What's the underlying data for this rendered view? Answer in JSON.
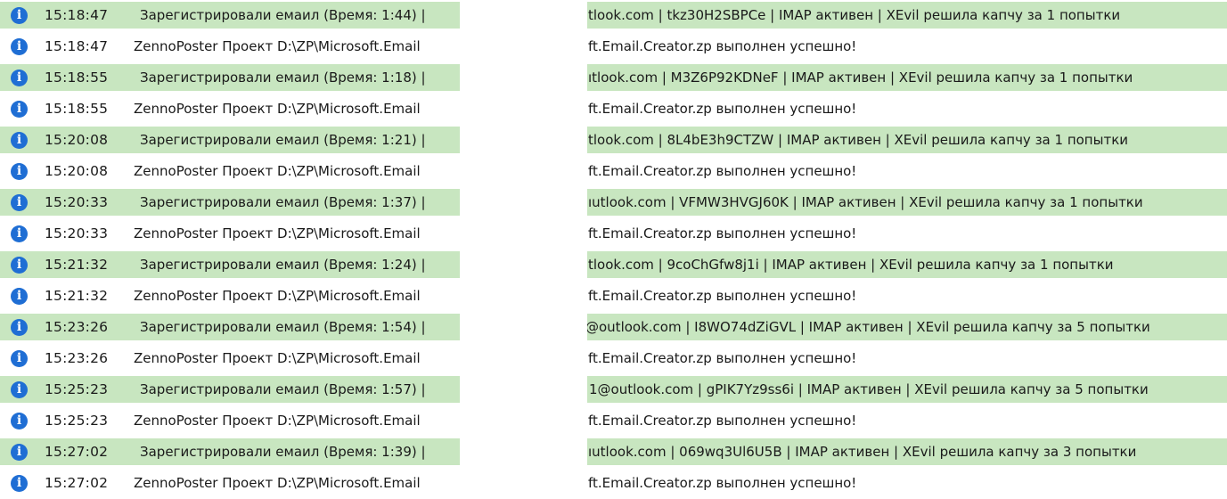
{
  "log": {
    "rows": [
      {
        "kind": "ok",
        "icon": "i",
        "time": "15:18:47",
        "left": "Зарегистрировали емаил (Время: 1:44) |",
        "right": "tlook.com | tkz30H2SBPCe | IMAP активен | XEvil решила капчу за 1 попытки"
      },
      {
        "kind": "info",
        "icon": "i",
        "time": "15:18:47",
        "left": "ZennoPoster Проект D:\\ZP\\Microsoft.Email",
        "right": "ft.Email.Creator.zp выполнен успешно!"
      },
      {
        "kind": "ok",
        "icon": "i",
        "time": "15:18:55",
        "left": "Зарегистрировали емаил (Время: 1:18) |",
        "right": "ıtlook.com | M3Z6P92KDNeF | IMAP активен | XEvil решила капчу за 1 попытки"
      },
      {
        "kind": "info",
        "icon": "i",
        "time": "15:18:55",
        "left": "ZennoPoster Проект D:\\ZP\\Microsoft.Email",
        "right": "ft.Email.Creator.zp выполнен успешно!"
      },
      {
        "kind": "ok",
        "icon": "i",
        "time": "15:20:08",
        "left": "Зарегистрировали емаил (Время: 1:21) |",
        "right": "tlook.com | 8L4bE3h9CTZW | IMAP активен | XEvil решила капчу за 1 попытки"
      },
      {
        "kind": "info",
        "icon": "i",
        "time": "15:20:08",
        "left": "ZennoPoster Проект D:\\ZP\\Microsoft.Email",
        "right": "ft.Email.Creator.zp выполнен успешно!"
      },
      {
        "kind": "ok",
        "icon": "i",
        "time": "15:20:33",
        "left": "Зарегистрировали емаил (Время: 1:37) |",
        "right": "ıutlook.com | VFMW3HVGJ60K | IMAP активен | XEvil решила капчу за 1 попытки"
      },
      {
        "kind": "info",
        "icon": "i",
        "time": "15:20:33",
        "left": "ZennoPoster Проект D:\\ZP\\Microsoft.Email",
        "right": "ft.Email.Creator.zp выполнен успешно!"
      },
      {
        "kind": "ok",
        "icon": "i",
        "time": "15:21:32",
        "left": "Зарегистрировали емаил (Время: 1:24) |",
        "right": "tlook.com | 9coChGfw8j1i | IMAP активен | XEvil решила капчу за 1 попытки"
      },
      {
        "kind": "info",
        "icon": "i",
        "time": "15:21:32",
        "left": "ZennoPoster Проект D:\\ZP\\Microsoft.Email",
        "right": "ft.Email.Creator.zp выполнен успешно!"
      },
      {
        "kind": "ok",
        "icon": "i",
        "time": "15:23:26",
        "left": "Зарегистрировали емаил (Время: 1:54) |",
        "right": "@outlook.com | I8WO74dZiGVL | IMAP активен | XEvil решила капчу за 5 попытки"
      },
      {
        "kind": "info",
        "icon": "i",
        "time": "15:23:26",
        "left": "ZennoPoster Проект D:\\ZP\\Microsoft.Email",
        "right": "ft.Email.Creator.zp выполнен успешно!"
      },
      {
        "kind": "ok",
        "icon": "i",
        "time": "15:25:23",
        "left": "Зарегистрировали емаил (Время: 1:57) |",
        "right": "1@outlook.com | gPIK7Yz9ss6i | IMAP активен | XEvil решила капчу за 5 попытки"
      },
      {
        "kind": "info",
        "icon": "i",
        "time": "15:25:23",
        "left": "ZennoPoster Проект D:\\ZP\\Microsoft.Email",
        "right": "ft.Email.Creator.zp выполнен успешно!"
      },
      {
        "kind": "ok",
        "icon": "i",
        "time": "15:27:02",
        "left": "Зарегистрировали емаил (Время: 1:39) |",
        "right": "ıutlook.com | 069wq3Ul6U5B | IMAP активен | XEvil решила капчу за 3 попытки"
      },
      {
        "kind": "info",
        "icon": "i",
        "time": "15:27:02",
        "left": "ZennoPoster Проект D:\\ZP\\Microsoft.Email",
        "right": "ft.Email.Creator.zp выполнен успешно!"
      }
    ]
  },
  "colors": {
    "ok_row_bg": "#c8e6c0",
    "info_row_bg": "#ffffff",
    "info_icon": "#1f6ed4"
  },
  "icons": {
    "row_icon": "info-icon"
  }
}
